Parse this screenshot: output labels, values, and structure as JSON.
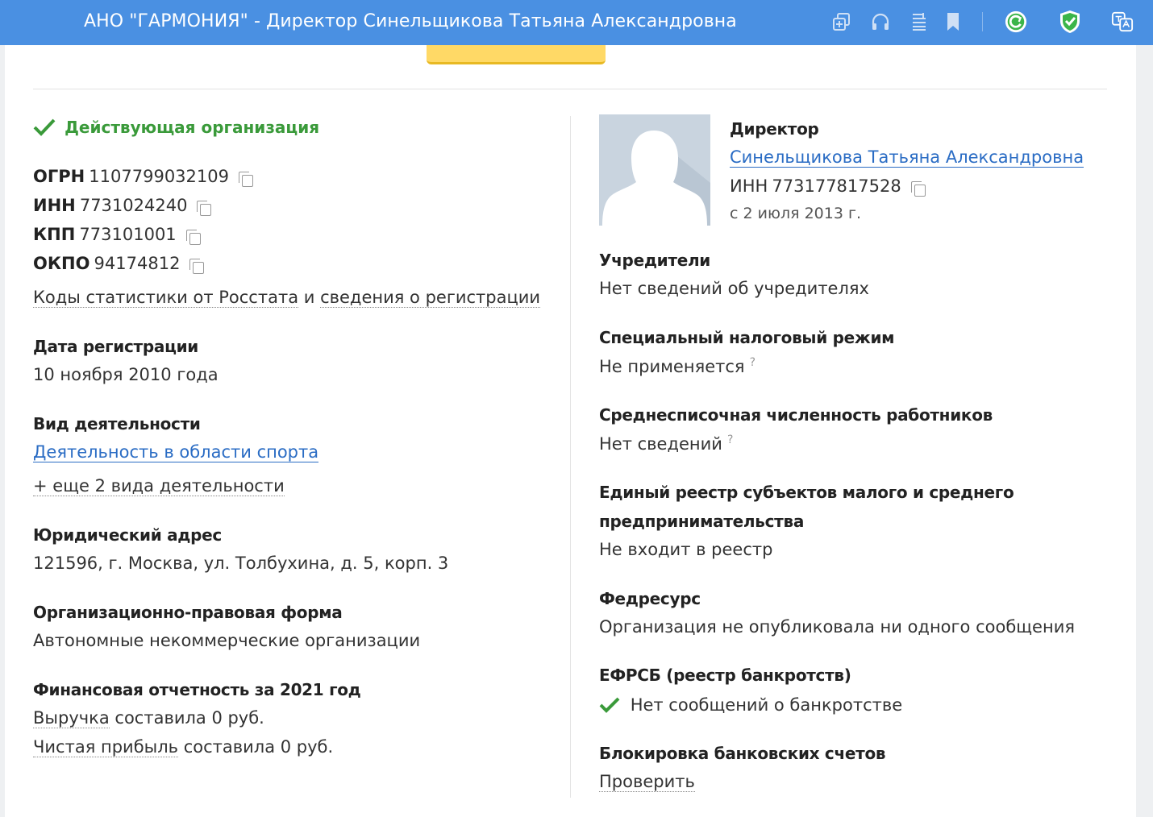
{
  "window": {
    "title": "АНО \"ГАРМОНИЯ\" - Директор Синельщикова Татьяна Александровна"
  },
  "toolbar_icons": [
    "add-window-icon",
    "headphones-icon",
    "reader-icon",
    "bookmark-icon",
    "refresh-ext-icon",
    "shield-check-icon",
    "translate-icon"
  ],
  "colors": {
    "topbar": "#4a90e2",
    "status_green": "#3a9a3a",
    "link_blue": "#2a6cc4",
    "yellow_button": "#ffd966"
  },
  "left": {
    "status": "Действующая организация",
    "codes": [
      {
        "label": "ОГРН",
        "value": "1107799032109"
      },
      {
        "label": "ИНН",
        "value": "7731024240"
      },
      {
        "label": "КПП",
        "value": "773101001"
      },
      {
        "label": "ОКПО",
        "value": "94174812"
      }
    ],
    "stats_link": "Коды статистики от Росстата",
    "stats_and": "и",
    "registration_link": "сведения о регистрации",
    "reg_date": {
      "heading": "Дата регистрации",
      "value": "10 ноября 2010 года"
    },
    "activity": {
      "heading": "Вид деятельности",
      "link": "Деятельность в области спорта",
      "more": "+ еще 2 вида деятельности"
    },
    "address": {
      "heading": "Юридический адрес",
      "value": "121596, г. Москва, ул. Толбухина, д. 5, корп. 3"
    },
    "legal_form": {
      "heading": "Организационно-правовая форма",
      "value": "Автономные некоммерческие организации"
    },
    "finance": {
      "heading": "Финансовая отчетность за 2021 год",
      "revenue_link": "Выручка",
      "revenue_text": "составила 0 руб.",
      "profit_link": "Чистая прибыль",
      "profit_text": "составила 0 руб."
    }
  },
  "right": {
    "director": {
      "role": "Директор",
      "name": "Синельщикова Татьяна Александровна",
      "inn_label": "ИНН",
      "inn": "773177817528",
      "since": "с 2 июля 2013 г."
    },
    "founders": {
      "heading": "Учредители",
      "value": "Нет сведений об учредителях"
    },
    "tax_regime": {
      "heading": "Специальный налоговый режим",
      "value": "Не применяется",
      "hint": "?"
    },
    "employees": {
      "heading": "Среднесписочная численность работников",
      "value": "Нет сведений",
      "hint": "?"
    },
    "msp": {
      "heading_line1": "Единый реестр субъектов малого и среднего",
      "heading_line2": "предпринимательства",
      "value": "Не входит в реестр"
    },
    "fedresurs": {
      "heading": "Федресурс",
      "value": "Организация не опубликовала ни одного сообщения"
    },
    "efrsb": {
      "heading": "ЕФРСБ (реестр банкротств)",
      "value": "Нет сообщений о банкротстве"
    },
    "bank_block": {
      "heading": "Блокировка банковских счетов",
      "link": "Проверить"
    }
  }
}
